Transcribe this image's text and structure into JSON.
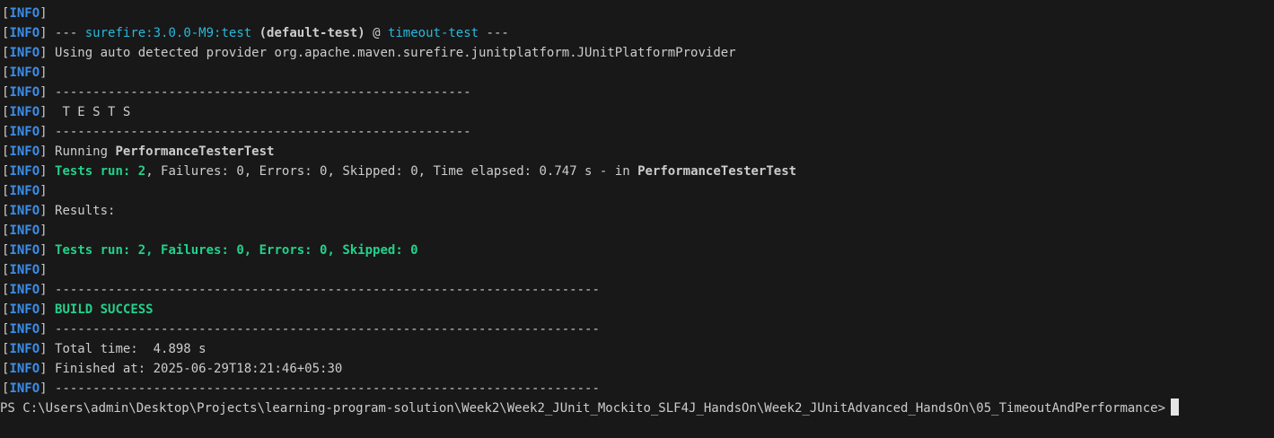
{
  "terminal": {
    "tag": "INFO",
    "lines": [
      {
        "seg": [
          {
            "t": "",
            "c": ""
          }
        ]
      },
      {
        "seg": [
          {
            "t": " --- ",
            "c": ""
          },
          {
            "t": "surefire:3.0.0-M9:test",
            "c": "cyan"
          },
          {
            "t": " ",
            "c": ""
          },
          {
            "t": "(default-test)",
            "c": "b"
          },
          {
            "t": " @ ",
            "c": ""
          },
          {
            "t": "timeout-test",
            "c": "cyan"
          },
          {
            "t": " ---",
            "c": ""
          }
        ]
      },
      {
        "seg": [
          {
            "t": " Using auto detected provider org.apache.maven.surefire.junitplatform.JUnitPlatformProvider",
            "c": ""
          }
        ]
      },
      {
        "seg": [
          {
            "t": "",
            "c": ""
          }
        ]
      },
      {
        "seg": [
          {
            "t": " -------------------------------------------------------",
            "c": ""
          }
        ]
      },
      {
        "seg": [
          {
            "t": "  T E S T S",
            "c": ""
          }
        ]
      },
      {
        "seg": [
          {
            "t": " -------------------------------------------------------",
            "c": ""
          }
        ]
      },
      {
        "seg": [
          {
            "t": " Running ",
            "c": ""
          },
          {
            "t": "PerformanceTesterTest",
            "c": "b"
          }
        ]
      },
      {
        "seg": [
          {
            "t": " ",
            "c": ""
          },
          {
            "t": "Tests run: 2",
            "c": "green"
          },
          {
            "t": ", Failures: 0, Errors: 0, Skipped: 0, Time elapsed: 0.747 s - in ",
            "c": ""
          },
          {
            "t": "PerformanceTesterTest",
            "c": "b"
          }
        ]
      },
      {
        "seg": [
          {
            "t": "",
            "c": ""
          }
        ]
      },
      {
        "seg": [
          {
            "t": " Results:",
            "c": ""
          }
        ]
      },
      {
        "seg": [
          {
            "t": "",
            "c": ""
          }
        ]
      },
      {
        "seg": [
          {
            "t": " ",
            "c": ""
          },
          {
            "t": "Tests run: 2, Failures: 0, Errors: 0, Skipped: 0",
            "c": "green"
          }
        ]
      },
      {
        "seg": [
          {
            "t": "",
            "c": ""
          }
        ]
      },
      {
        "seg": [
          {
            "t": " ------------------------------------------------------------------------",
            "c": ""
          }
        ]
      },
      {
        "seg": [
          {
            "t": " ",
            "c": ""
          },
          {
            "t": "BUILD SUCCESS",
            "c": "green"
          }
        ]
      },
      {
        "seg": [
          {
            "t": " ------------------------------------------------------------------------",
            "c": ""
          }
        ]
      },
      {
        "seg": [
          {
            "t": " Total time:  4.898 s",
            "c": ""
          }
        ]
      },
      {
        "seg": [
          {
            "t": " Finished at: 2025-06-29T18:21:46+05:30",
            "c": ""
          }
        ]
      },
      {
        "seg": [
          {
            "t": " ------------------------------------------------------------------------",
            "c": ""
          }
        ]
      }
    ],
    "prompt": "PS C:\\Users\\admin\\Desktop\\Projects\\learning-program-solution\\Week2\\Week2_JUnit_Mockito_SLF4J_HandsOn\\Week2_JUnitAdvanced_HandsOn\\05_TimeoutAndPerformance>",
    "colors": {
      "background": "#181818",
      "info": "#3b8eea",
      "cyan": "#29b8db",
      "green": "#23d18b",
      "text": "#cccccc"
    },
    "icons": [
      "cursor-block"
    ]
  }
}
